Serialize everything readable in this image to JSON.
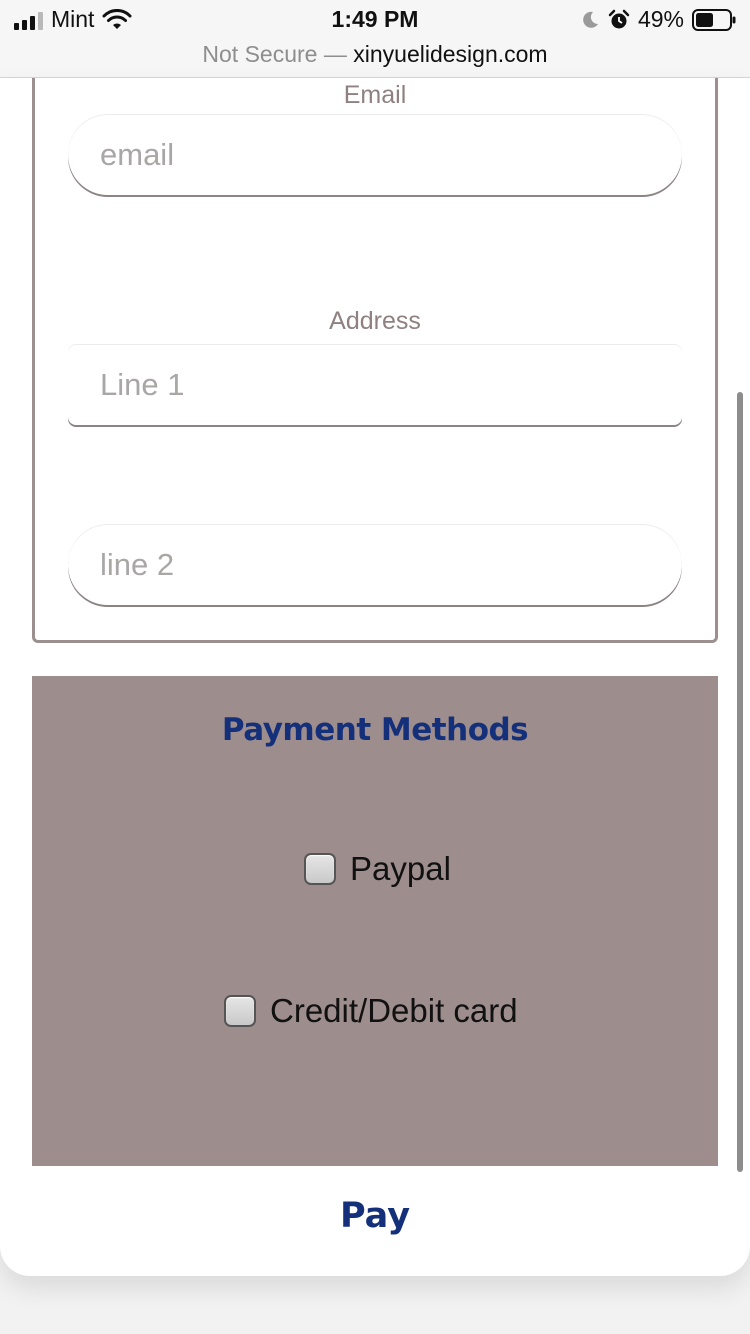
{
  "status_bar": {
    "carrier": "Mint",
    "time": "1:49 PM",
    "battery_percent": "49%"
  },
  "url_bar": {
    "security_label": "Not Secure",
    "separator": "—",
    "domain": "xinyuelidesign.com"
  },
  "form": {
    "email_label": "Email",
    "email_placeholder": "email",
    "address_label": "Address",
    "line1_placeholder": "Line 1",
    "line2_placeholder": "line 2"
  },
  "payment": {
    "title": "Payment Methods",
    "options": [
      {
        "label": "Paypal",
        "checked": false
      },
      {
        "label": "Credit/Debit card",
        "checked": false
      }
    ]
  },
  "pay_label": "Pay",
  "colors": {
    "panel": "#9e8d8d",
    "accent": "#14307a",
    "label": "#8f8181"
  }
}
